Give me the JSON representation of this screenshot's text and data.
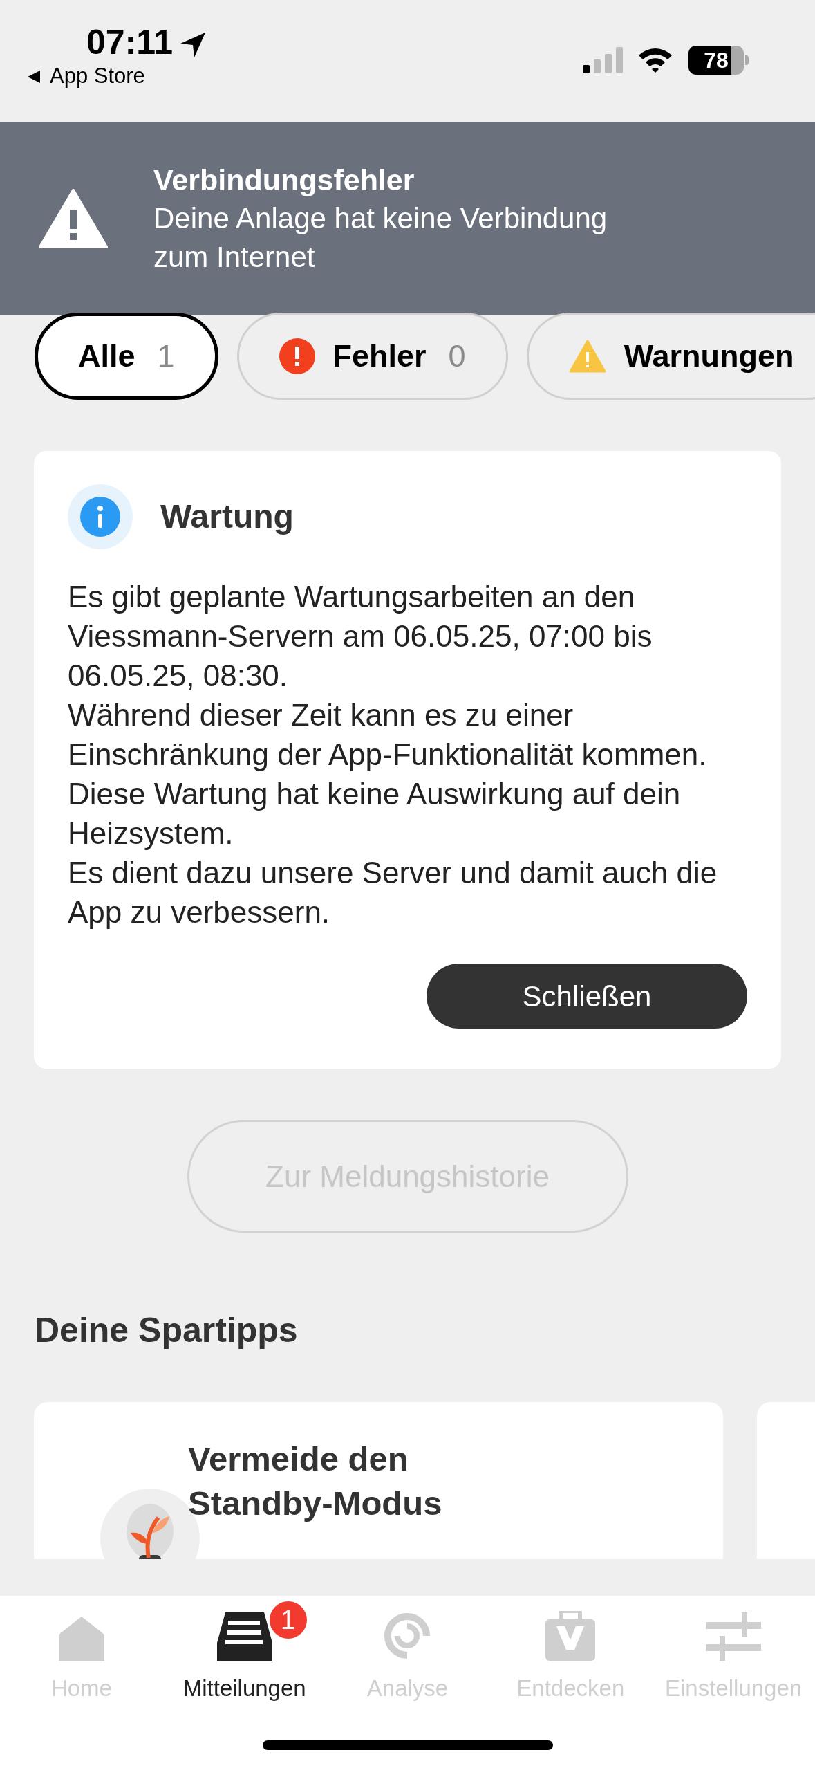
{
  "status_bar": {
    "time": "07:11",
    "back_label": "App Store",
    "battery": "78"
  },
  "banner": {
    "title": "Verbindungsfehler",
    "message": "Deine Anlage hat keine Verbindung zum Internet"
  },
  "filters": [
    {
      "kind": "all",
      "label": "Alle",
      "count": "1",
      "selected": true
    },
    {
      "kind": "error",
      "label": "Fehler",
      "count": "0",
      "selected": false
    },
    {
      "kind": "warning",
      "label": "Warnungen",
      "selected": false
    }
  ],
  "message_card": {
    "title": "Wartung",
    "paragraphs": [
      "Es gibt geplante Wartungsarbeiten an den Viessmann-Servern am 06.05.25, 07:00 bis 06.05.25, 08:30.",
      "Während dieser Zeit kann es zu einer Einschränkung der App-Funktionalität kommen.",
      "Diese Wartung hat keine Auswirkung auf dein Heizsystem.",
      "Es dient dazu unsere Server und damit auch die App zu verbessern."
    ],
    "button": "Schließen"
  },
  "history_button": {
    "label": "Zur Meldungshistorie",
    "disabled": true
  },
  "tips": {
    "title": "Deine Spartipps",
    "cards": [
      {
        "title": "Vermeide den Standby-Modus"
      }
    ]
  },
  "tab_bar": [
    {
      "kind": "home",
      "label": "Home",
      "selected": false
    },
    {
      "kind": "messages",
      "label": "Mitteilungen",
      "selected": true,
      "badge": "1"
    },
    {
      "kind": "analysis",
      "label": "Analyse",
      "selected": false
    },
    {
      "kind": "discover",
      "label": "Entdecken",
      "selected": false
    },
    {
      "kind": "settings",
      "label": "Einstellungen",
      "selected": false
    }
  ]
}
